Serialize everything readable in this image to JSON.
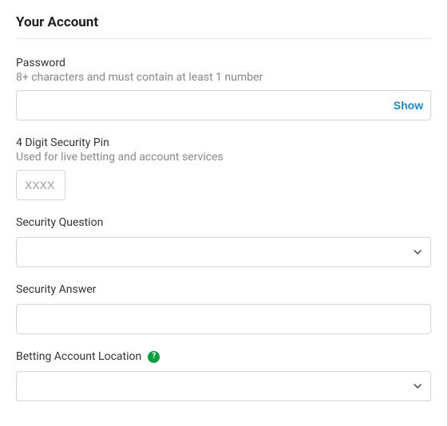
{
  "section": {
    "title": "Your Account"
  },
  "password": {
    "label": "Password",
    "hint": "8+ characters and must contain at least 1 number",
    "show_label": "Show"
  },
  "pin": {
    "label": "4 Digit Security Pin",
    "hint": "Used for live betting and account services",
    "placeholder": "XXXX"
  },
  "security_question": {
    "label": "Security Question"
  },
  "security_answer": {
    "label": "Security Answer"
  },
  "betting_location": {
    "label": "Betting Account Location",
    "help_glyph": "?"
  }
}
